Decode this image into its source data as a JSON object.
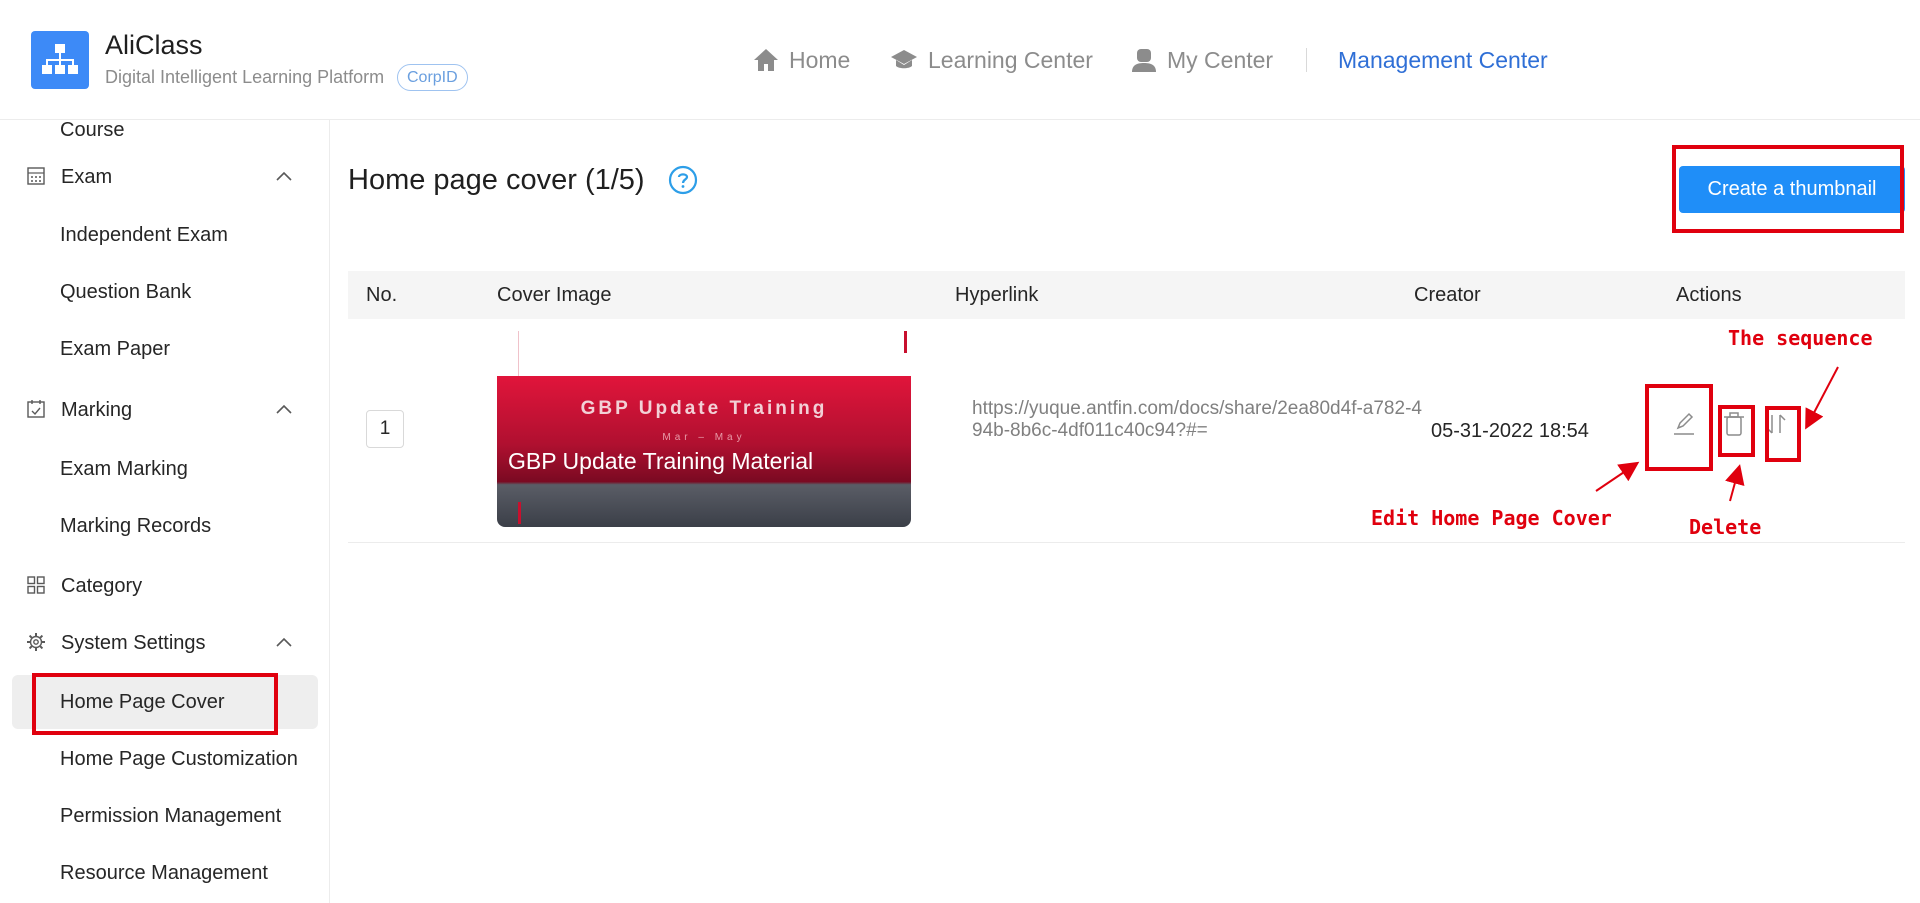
{
  "header": {
    "app_name": "AliClass",
    "subtitle": "Digital Intelligent Learning Platform",
    "corp_badge": "CorpID",
    "nav": {
      "home": "Home",
      "learning": "Learning Center",
      "my": "My Center",
      "management": "Management Center"
    }
  },
  "sidebar": {
    "partial_top": "Course",
    "groups": {
      "exam": "Exam",
      "marking": "Marking",
      "category": "Category",
      "system": "System Settings"
    },
    "items": {
      "independent_exam": "Independent Exam",
      "question_bank": "Question Bank",
      "exam_paper": "Exam Paper",
      "exam_marking": "Exam Marking",
      "marking_records": "Marking Records",
      "home_page_cover": "Home Page Cover",
      "home_page_customization": "Home Page Customization",
      "permission_management": "Permission Management",
      "resource_management": "Resource Management"
    }
  },
  "main": {
    "title": "Home page cover (1/5)",
    "create_button": "Create a thumbnail",
    "columns": {
      "no": "No.",
      "cover": "Cover Image",
      "hyperlink": "Hyperlink",
      "creator": "Creator",
      "actions": "Actions"
    },
    "rows": [
      {
        "no": "1",
        "cover_banner": "GBP Update Training",
        "cover_sub": "Mar – May",
        "cover_title": "GBP Update Training Material",
        "hyperlink": "https://yuque.antfin.com/docs/share/2ea80d4f-a782-494b-8b6c-4df011c40c94?#=",
        "created": "05-31-2022 18:54"
      }
    ]
  },
  "annotations": {
    "sequence": "The sequence",
    "edit": "Edit Home Page Cover",
    "delete": "Delete",
    "color": "#e0000e"
  },
  "colors": {
    "accent": "#1f8ef8",
    "nav_active": "#2f6fd6",
    "logo": "#3d8af7"
  }
}
